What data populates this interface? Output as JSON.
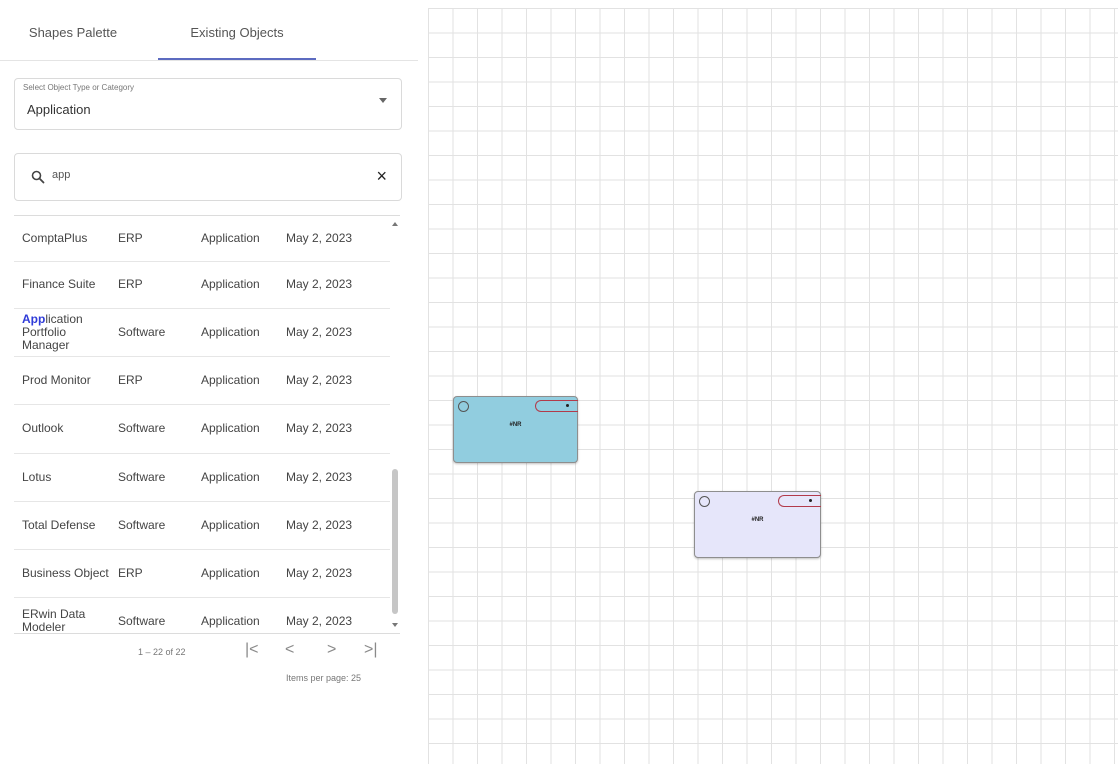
{
  "tabs": [
    {
      "label": "Shapes Palette"
    },
    {
      "label": "Existing Objects"
    }
  ],
  "select": {
    "label": "Select Object Type or Category",
    "value": "Application"
  },
  "search": {
    "value": "app",
    "clear_label": "×"
  },
  "rows": [
    {
      "name": "ComptaPlus",
      "category": "ERP",
      "type": "Application",
      "date": "May 2, 2023"
    },
    {
      "name": "Finance Suite",
      "category": "ERP",
      "type": "Application",
      "date": "May 2, 2023"
    },
    {
      "name_highlight": "App",
      "name_rest": "lication Portfolio Manager",
      "category": "Software",
      "type": "Application",
      "date": "May 2, 2023"
    },
    {
      "name": "Prod Monitor",
      "category": "ERP",
      "type": "Application",
      "date": "May 2, 2023"
    },
    {
      "name": "Outlook",
      "category": "Software",
      "type": "Application",
      "date": "May 2, 2023"
    },
    {
      "name": "Lotus",
      "category": "Software",
      "type": "Application",
      "date": "May 2, 2023"
    },
    {
      "name": "Total Defense",
      "category": "Software",
      "type": "Application",
      "date": "May 2, 2023"
    },
    {
      "name": "Business Object",
      "category": "ERP",
      "type": "Application",
      "date": "May 2, 2023"
    },
    {
      "name": "ERwin Data Modeler",
      "category": "Software",
      "type": "Application",
      "date": "May 2, 2023"
    }
  ],
  "pager": {
    "range": "1 – 22 of 22",
    "first": "|<",
    "prev": "<",
    "next": ">",
    "last": ">|",
    "per_page": "Items per page: 25"
  },
  "nodes": [
    {
      "label": "#NR",
      "color": "#91cddf"
    },
    {
      "label": "#NR",
      "color": "#e6e6fa"
    }
  ]
}
